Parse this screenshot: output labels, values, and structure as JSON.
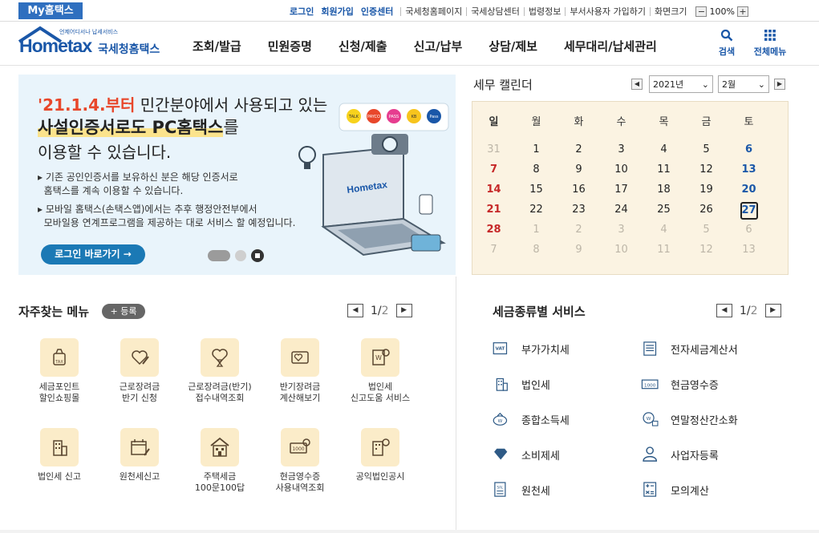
{
  "topbar": {
    "brand": "My홈택스",
    "links_bold": [
      "로그인",
      "회원가입",
      "인증센터"
    ],
    "links": [
      "국세청홈페이지",
      "국세상담센터",
      "법령정보",
      "부서사용자 가입하기",
      "화면크기"
    ],
    "zoom_minus": "−",
    "zoom_value": "100%",
    "zoom_plus": "+"
  },
  "logo": {
    "sub": "언제어디서나 납세서비스",
    "main": "Hometax",
    "nts": "국세청홈택스"
  },
  "gnb": [
    "조회/발급",
    "민원증명",
    "신청/제출",
    "신고/납부",
    "상담/제보",
    "세무대리/납세관리"
  ],
  "search_label": "검색",
  "allmenu_label": "전체메뉴",
  "banner": {
    "line1_highlight": "'21.1.4.부터",
    "line1_rest": " 민간분야에서 사용되고 있는",
    "line2_highlight": "사설인증서로도 PC홈택스",
    "line2_rest": "를",
    "line3": "이용할 수 있습니다.",
    "desc1a": "▸ 기존 공인인증서를 보유하신 분은 해당 인증서로",
    "desc1b": "홈택스를 계속 이용할 수 있습니다.",
    "desc2a": "▸ 모바일 홈택스(손택스앱)에서는 추후 행정안전부에서",
    "desc2b": "모바일용 연계프로그램을 제공하는 대로 서비스 할 예정입니다.",
    "login_button": "로그인 바로가기  →",
    "screen_logo": "Hometax",
    "badges": [
      "TALK",
      "PAYCO",
      "PASS",
      "KB",
      "Pass"
    ]
  },
  "calendar": {
    "title": "세무 캘린더",
    "year": "2021년",
    "month": "2월",
    "weekdays": [
      "일",
      "월",
      "화",
      "수",
      "목",
      "금",
      "토"
    ],
    "weeks": [
      [
        "31",
        "1",
        "2",
        "3",
        "4",
        "5",
        "6"
      ],
      [
        "7",
        "8",
        "9",
        "10",
        "11",
        "12",
        "13"
      ],
      [
        "14",
        "15",
        "16",
        "17",
        "18",
        "19",
        "20"
      ],
      [
        "21",
        "22",
        "23",
        "24",
        "25",
        "26",
        "27"
      ],
      [
        "28",
        "1",
        "2",
        "3",
        "4",
        "5",
        "6"
      ],
      [
        "7",
        "8",
        "9",
        "10",
        "11",
        "12",
        "13"
      ]
    ],
    "today": "27"
  },
  "favorites": {
    "title": "자주찾는 메뉴",
    "add_button": "+ 등록",
    "page": "1",
    "pages": "2",
    "items": [
      {
        "label1": "세금포인트",
        "label2": "할인쇼핑몰",
        "icon": "tax-bag-icon"
      },
      {
        "label1": "근로장려금",
        "label2": "반기 신청",
        "icon": "heart-pen-icon"
      },
      {
        "label1": "근로장려금(반기)",
        "label2": "접수내역조회",
        "icon": "heart-hourglass-icon"
      },
      {
        "label1": "반기장려금",
        "label2": "계산해보기",
        "icon": "heart-card-icon"
      },
      {
        "label1": "법인세",
        "label2": "신고도움 서비스",
        "icon": "won-doc-search-icon"
      },
      {
        "label1": "법인세 신고",
        "label2": "",
        "icon": "building-icon"
      },
      {
        "label1": "원천세신고",
        "label2": "",
        "icon": "calendar-pen-icon"
      },
      {
        "label1": "주택세금",
        "label2": "100문100답",
        "icon": "house-icon"
      },
      {
        "label1": "현금영수증",
        "label2": "사용내역조회",
        "icon": "receipt-search-icon"
      },
      {
        "label1": "공익법인공시",
        "label2": "",
        "icon": "building-search-icon"
      }
    ]
  },
  "taxservices": {
    "title": "세금종류별 서비스",
    "page": "1",
    "pages": "2",
    "items": [
      {
        "label": "부가가치세",
        "icon": "vat-icon"
      },
      {
        "label": "전자세금계산서",
        "icon": "calculator-doc-icon"
      },
      {
        "label": "법인세",
        "icon": "building-icon"
      },
      {
        "label": "현금영수증",
        "icon": "cash-1000-icon"
      },
      {
        "label": "종합소득세",
        "icon": "money-bag-icon"
      },
      {
        "label": "연말정산간소화",
        "icon": "won-search-icon"
      },
      {
        "label": "소비제세",
        "icon": "diamond-icon"
      },
      {
        "label": "사업자등록",
        "icon": "person-icon"
      },
      {
        "label": "원천세",
        "icon": "sal-doc-icon"
      },
      {
        "label": "모의계산",
        "icon": "calc-icon"
      }
    ]
  },
  "colors": {
    "brand": "#1a57a8",
    "accent": "#e8472b",
    "sunday": "#c62828",
    "saturday": "#1a57a8"
  }
}
